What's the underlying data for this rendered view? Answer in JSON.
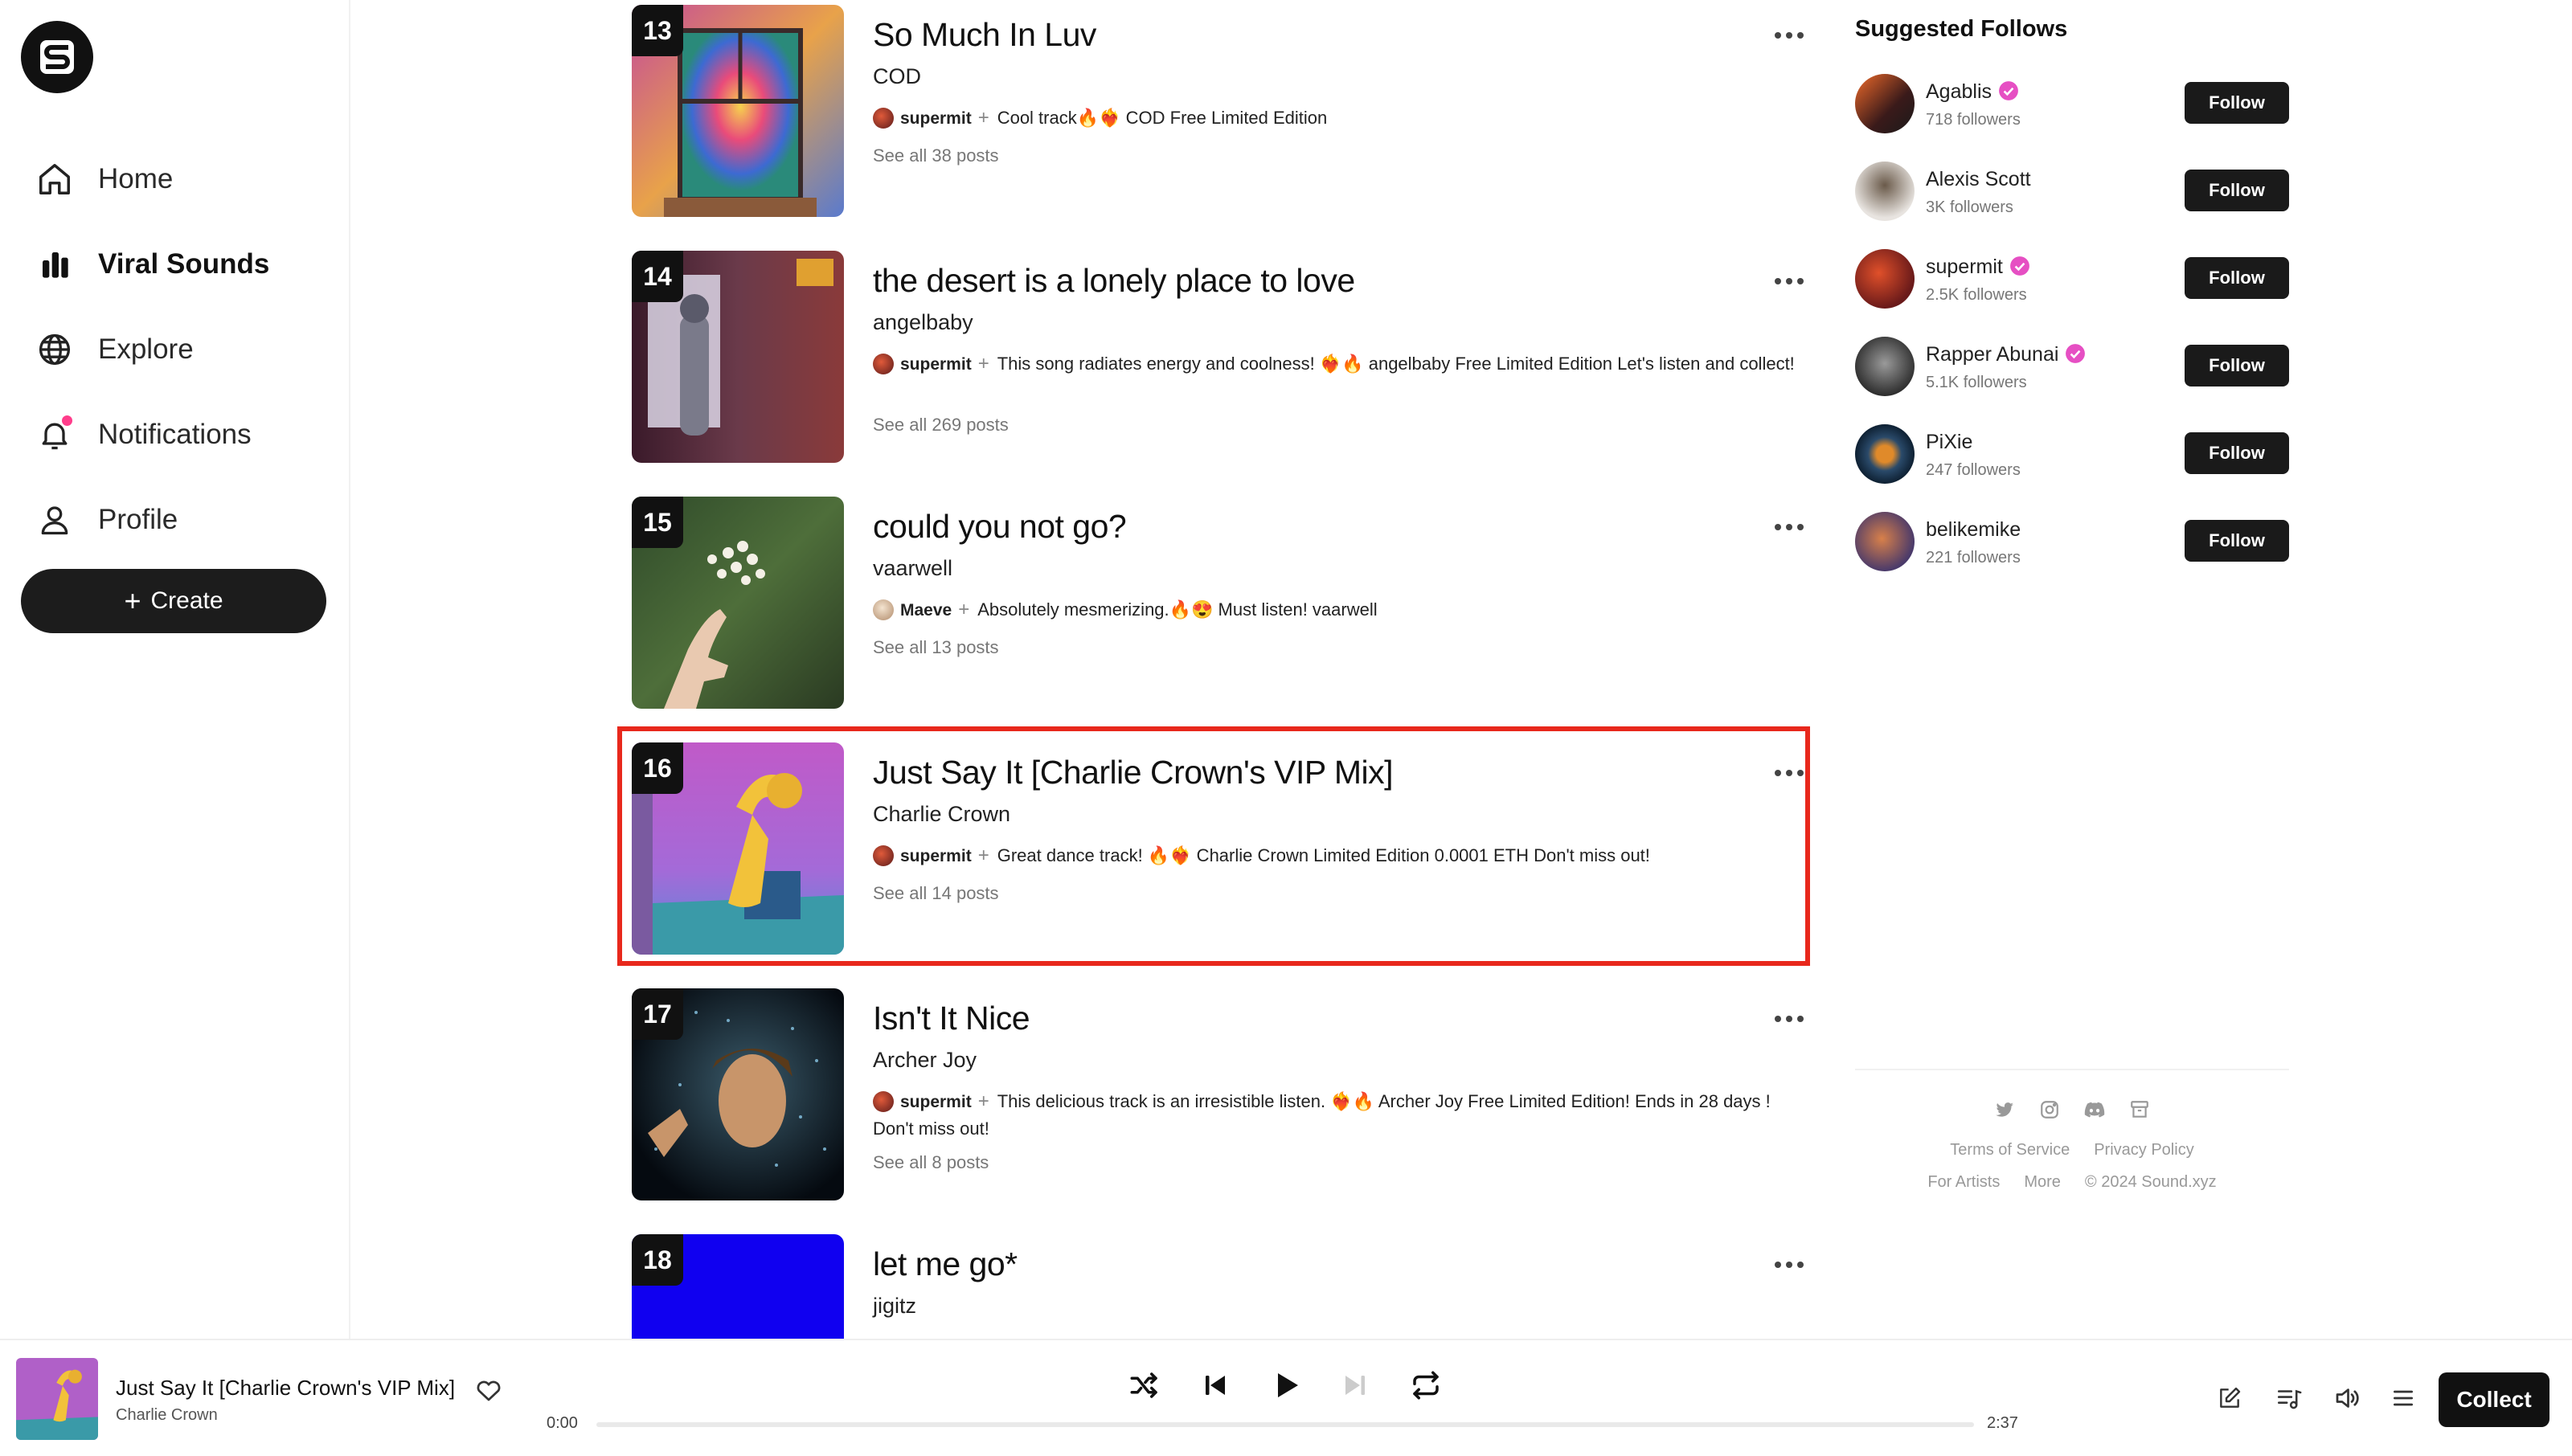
{
  "sidebar": {
    "nav": [
      {
        "label": "Home",
        "icon": "home-icon",
        "active": false
      },
      {
        "label": "Viral Sounds",
        "icon": "bar-chart-icon",
        "active": true
      },
      {
        "label": "Explore",
        "icon": "globe-icon",
        "active": false
      },
      {
        "label": "Notifications",
        "icon": "bell-icon",
        "active": false,
        "has_dot": true
      },
      {
        "label": "Profile",
        "icon": "user-icon",
        "active": false
      }
    ],
    "create_label": "Create"
  },
  "feed": {
    "tracks": [
      {
        "rank": "13",
        "title": "So Much In Luv",
        "artist": "COD",
        "post_user": "supermit",
        "post_text": "Cool track🔥❤️‍🔥 COD Free Limited Edition",
        "see_all": "See all 38 posts"
      },
      {
        "rank": "14",
        "title": "the desert is a lonely place to love",
        "artist": "angelbaby",
        "post_user": "supermit",
        "post_text": "This song radiates energy and coolness! ❤️‍🔥🔥 angelbaby Free Limited Edition Let's listen and collect!",
        "see_all": "See all 269 posts"
      },
      {
        "rank": "15",
        "title": "could you not go?",
        "artist": "vaarwell",
        "post_user": "Maeve",
        "post_text": "Absolutely mesmerizing.🔥😍 Must listen! vaarwell",
        "see_all": "See all 13 posts"
      },
      {
        "rank": "16",
        "title": "Just Say It [Charlie Crown's VIP Mix]",
        "artist": "Charlie Crown",
        "post_user": "supermit",
        "post_text": "Great dance track! 🔥❤️‍🔥 Charlie Crown Limited Edition 0.0001 ETH Don't miss out!",
        "see_all": "See all 14 posts",
        "highlighted": true
      },
      {
        "rank": "17",
        "title": "Isn't It Nice",
        "artist": "Archer Joy",
        "post_user": "supermit",
        "post_text": "This delicious track is an irresistible listen. ❤️‍🔥🔥 Archer Joy Free Limited Edition! Ends in 28 days ! Don't miss out!",
        "see_all": "See all 8 posts"
      },
      {
        "rank": "18",
        "title": "let me go*",
        "artist": "jigitz"
      }
    ]
  },
  "suggested": {
    "title": "Suggested Follows",
    "follow_label": "Follow",
    "users": [
      {
        "name": "Agablis",
        "followers": "718 followers",
        "verified": true
      },
      {
        "name": "Alexis Scott",
        "followers": "3K followers",
        "verified": false
      },
      {
        "name": "supermit",
        "followers": "2.5K followers",
        "verified": true
      },
      {
        "name": "Rapper Abunai",
        "followers": "5.1K followers",
        "verified": true
      },
      {
        "name": "PiXie",
        "followers": "247 followers",
        "verified": false
      },
      {
        "name": "belikemike",
        "followers": "221 followers",
        "verified": false
      }
    ]
  },
  "footer": {
    "social_icons": [
      "twitter-icon",
      "instagram-icon",
      "discord-icon",
      "archive-icon"
    ],
    "terms": "Terms of Service",
    "privacy": "Privacy Policy",
    "for_artists": "For Artists",
    "more": "More",
    "copyright": "© 2024 Sound.xyz"
  },
  "player": {
    "title": "Just Say It [Charlie Crown's VIP Mix]",
    "artist": "Charlie Crown",
    "elapsed": "0:00",
    "duration": "2:37",
    "progress": 0,
    "collect_label": "Collect"
  },
  "colors": {
    "accent": "#111111",
    "highlight_border": "#e8281c",
    "verified": "#e64fc3",
    "notification_dot": "#ff3d8b"
  }
}
